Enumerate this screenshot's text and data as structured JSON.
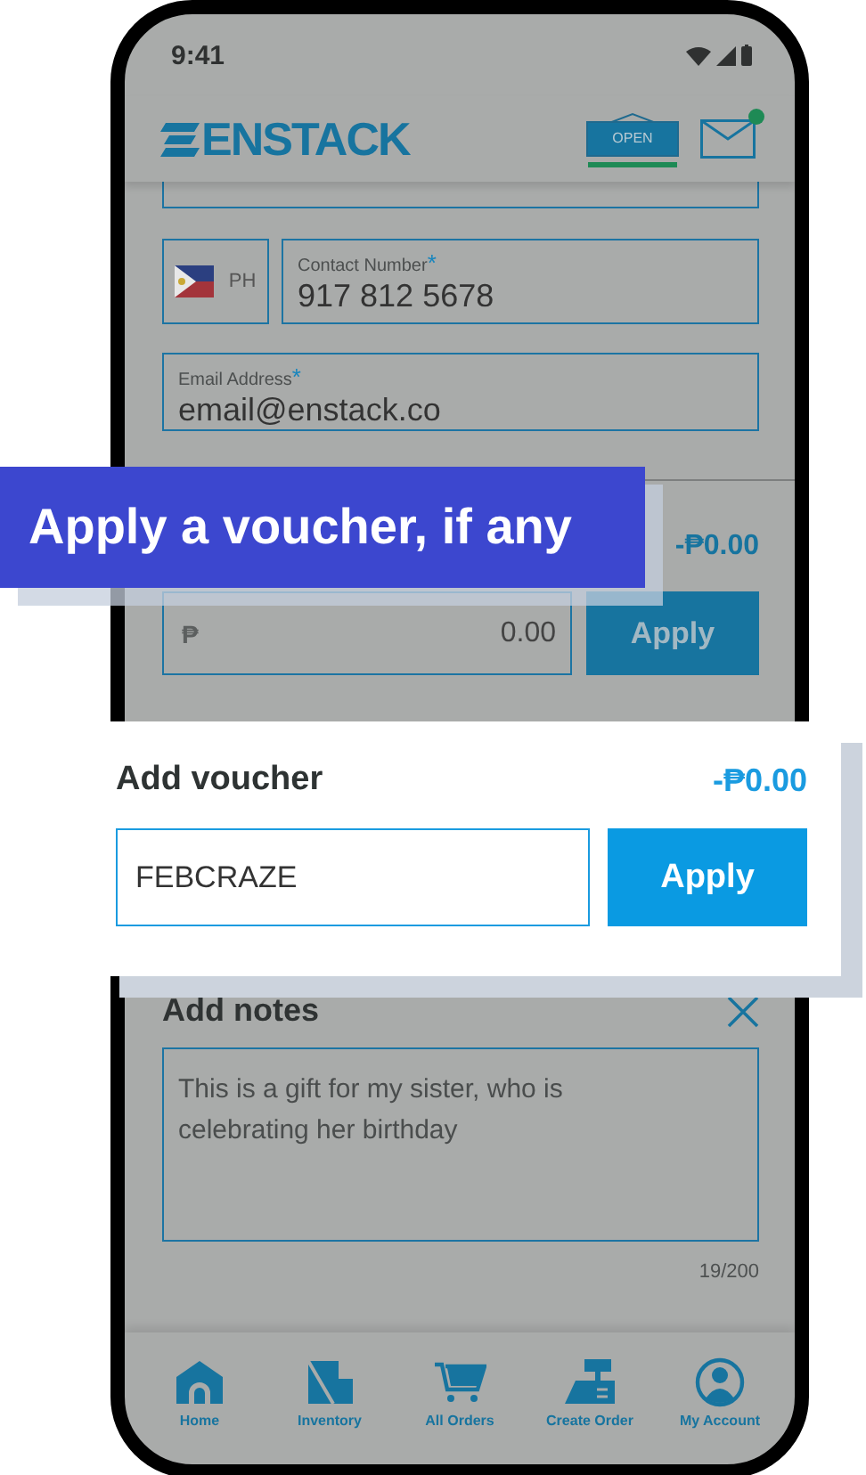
{
  "status_bar": {
    "time": "9:41"
  },
  "header": {
    "logo": "ENSTACK",
    "store_sign": "OPEN",
    "has_unread": true
  },
  "contact": {
    "country_code": "PH",
    "label": "Contact Number",
    "required_mark": "*",
    "value": "917 812 5678"
  },
  "email": {
    "label": "Email Address",
    "required_mark": "*",
    "value": "email@enstack.co"
  },
  "voucher": {
    "amount": "-₱0.00",
    "currency": "₱",
    "value": "0.00",
    "button": "Apply"
  },
  "notes": {
    "title": "Add notes",
    "value": "This is a gift for my sister, who is celebrating her birthday",
    "counter": "19/200"
  },
  "nav": [
    {
      "label": "Home",
      "kind": "home"
    },
    {
      "label": "Inventory",
      "kind": "inventory"
    },
    {
      "label": "All Orders",
      "kind": "cart"
    },
    {
      "label": "Create Order",
      "kind": "register"
    },
    {
      "label": "My Account",
      "kind": "account"
    }
  ],
  "callout": {
    "text": "Apply a voucher, if any"
  },
  "voucher_card": {
    "title": "Add voucher",
    "amount": "-₱0.00",
    "value": "FEBCRAZE",
    "button": "Apply"
  }
}
